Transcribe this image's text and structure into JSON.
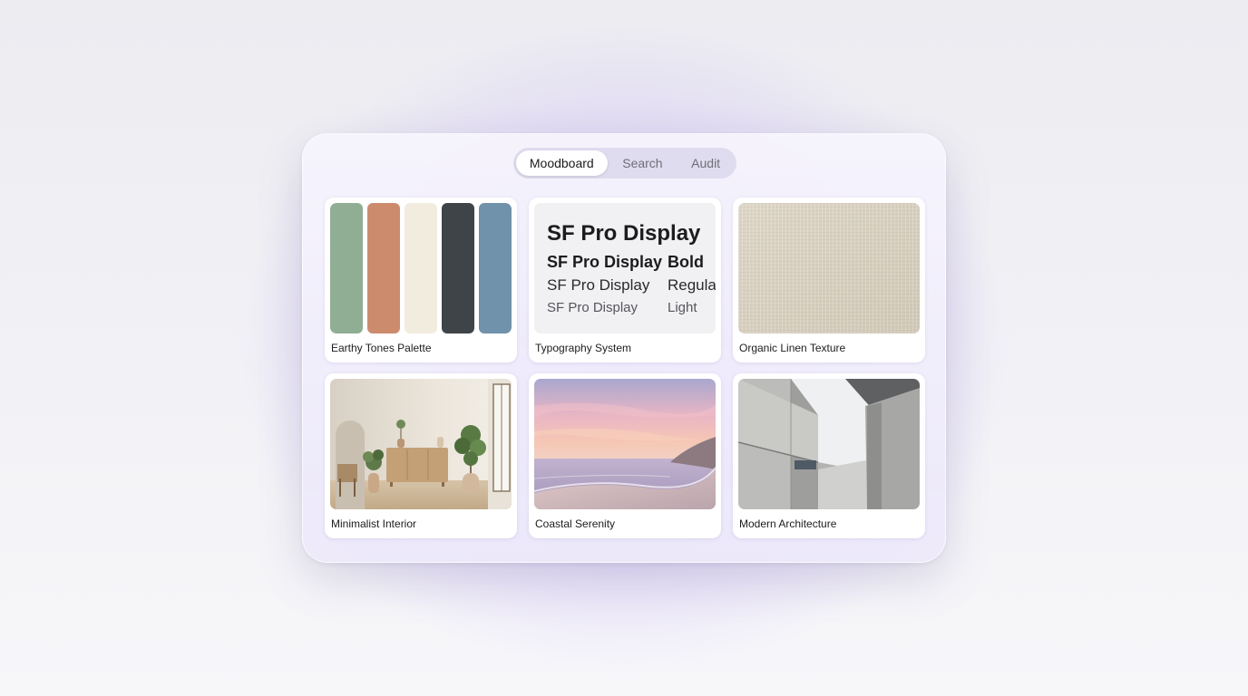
{
  "tabs": [
    {
      "label": "Moodboard",
      "active": true
    },
    {
      "label": "Search",
      "active": false
    },
    {
      "label": "Audit",
      "active": false
    }
  ],
  "cards": [
    {
      "label": "Earthy Tones Palette",
      "swatches": [
        "#8fae94",
        "#cd8b6e",
        "#f2ecdf",
        "#3f4448",
        "#7092ab"
      ]
    },
    {
      "label": "Typography System",
      "samples": {
        "heading": "SF Pro Display",
        "bold": {
          "text": "SF Pro Display",
          "weight": "Bold"
        },
        "regular": {
          "text": "SF Pro Display",
          "weight": "Regula"
        },
        "light": {
          "text": "SF Pro Display",
          "weight": "Light"
        }
      }
    },
    {
      "label": "Organic Linen Texture",
      "color": "#d9d1c1"
    },
    {
      "label": "Minimalist Interior"
    },
    {
      "label": "Coastal Serenity"
    },
    {
      "label": "Modern Architecture"
    }
  ],
  "colors": {
    "accent_glow": "#a078f0",
    "window_bg": "#f2f0fa"
  }
}
